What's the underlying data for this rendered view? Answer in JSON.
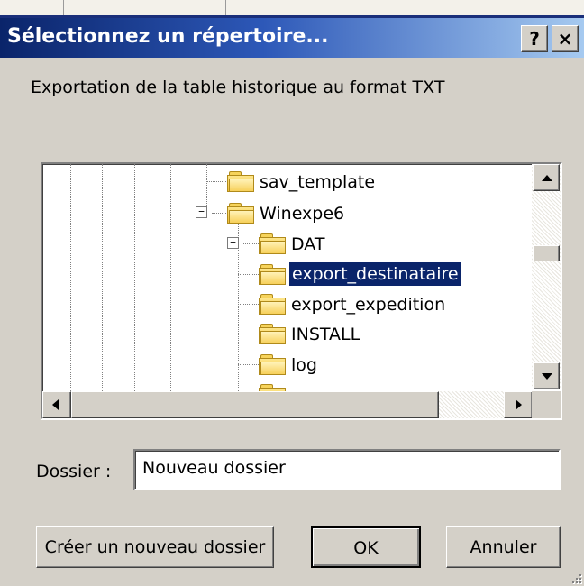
{
  "window": {
    "title": "Sélectionnez un répertoire...",
    "help_label": "?",
    "close_label": "×"
  },
  "description": "Exportation de la table historique au format TXT",
  "tree": {
    "items": [
      {
        "label": "sav_template",
        "expander": "",
        "selected": false
      },
      {
        "label": "Winexpe6",
        "expander": "−",
        "selected": false
      },
      {
        "label": "DAT",
        "expander": "+",
        "selected": false
      },
      {
        "label": "export_destinataire",
        "expander": "",
        "selected": true
      },
      {
        "label": "export_expedition",
        "expander": "",
        "selected": false
      },
      {
        "label": "INSTALL",
        "expander": "",
        "selected": false
      },
      {
        "label": "log",
        "expander": "",
        "selected": false
      }
    ]
  },
  "folder_field": {
    "label": "Dossier :",
    "value": "Nouveau dossier"
  },
  "buttons": {
    "create": "Créer un nouveau dossier",
    "ok": "OK",
    "cancel": "Annuler"
  },
  "colors": {
    "titlebar_start": "#0a246a",
    "titlebar_end": "#a6caf0",
    "selection": "#0a246a",
    "dialog_face": "#d4d0c8"
  }
}
